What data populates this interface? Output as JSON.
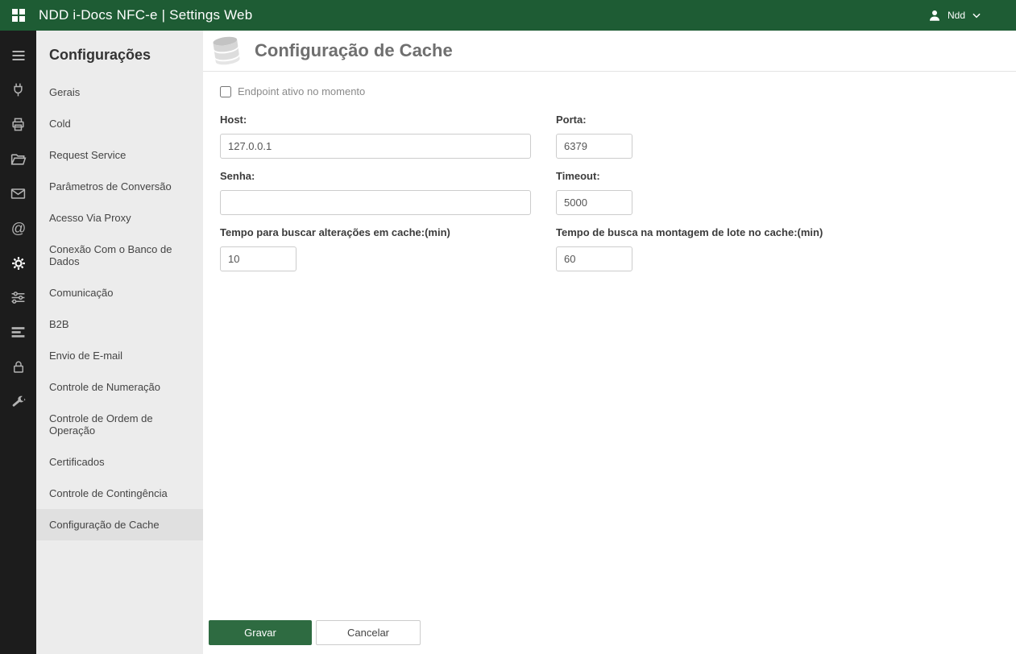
{
  "topbar": {
    "title": "NDD i-Docs NFC-e | Settings Web",
    "user_label": "Ndd"
  },
  "icons": {
    "topbar": [
      "apps-grid-icon",
      "user-icon",
      "chevron-down-icon"
    ],
    "rail": [
      "menu-icon",
      "plug-icon",
      "printer-icon",
      "folder-open-icon",
      "envelope-icon",
      "at-icon",
      "gear-icon",
      "sliders-icon",
      "server-icon",
      "lock-icon",
      "wrench-icon"
    ],
    "rail_active": "gear-icon",
    "header": "cache-database-icon"
  },
  "colors": {
    "topbar_green": "#1e5c34",
    "primary_button_green": "#2e6b41",
    "rail_bg": "#1c1c1c",
    "sidebar_bg": "#ececec",
    "sidebar_active_bg": "#e0e0e0"
  },
  "sidebar": {
    "title": "Configurações",
    "items": [
      {
        "label": "Gerais"
      },
      {
        "label": "Cold"
      },
      {
        "label": "Request Service"
      },
      {
        "label": "Parâmetros de Conversão"
      },
      {
        "label": "Acesso Via Proxy"
      },
      {
        "label": "Conexão Com o Banco de Dados"
      },
      {
        "label": "Comunicação"
      },
      {
        "label": "B2B"
      },
      {
        "label": "Envio de E-mail"
      },
      {
        "label": "Controle de Numeração"
      },
      {
        "label": "Controle de Ordem de Operação"
      },
      {
        "label": "Certificados"
      },
      {
        "label": "Controle de Contingência"
      },
      {
        "label": "Configuração de Cache"
      }
    ],
    "active_item": "Configuração de Cache"
  },
  "main": {
    "title": "Configuração de Cache",
    "checkbox": {
      "label": "Endpoint ativo no momento",
      "checked": false
    },
    "fields": {
      "host": {
        "label": "Host:",
        "value": "127.0.0.1"
      },
      "porta": {
        "label": "Porta:",
        "value": "6379"
      },
      "senha": {
        "label": "Senha:",
        "value": ""
      },
      "timeout": {
        "label": "Timeout:",
        "value": "5000"
      },
      "tempo_buscar": {
        "label": "Tempo para buscar alterações em cache:(min)",
        "value": "10"
      },
      "tempo_lote": {
        "label": "Tempo de busca na montagem de lote no cache:(min)",
        "value": "60"
      }
    },
    "buttons": {
      "save": "Gravar",
      "cancel": "Cancelar"
    }
  }
}
